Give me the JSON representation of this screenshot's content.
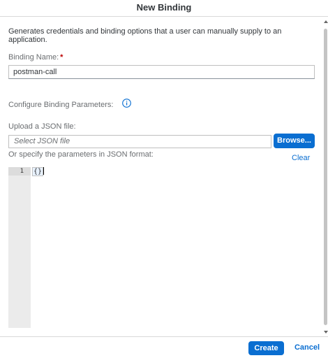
{
  "dialog": {
    "title": "New Binding"
  },
  "form": {
    "description": "Generates credentials and binding options that a user can manually supply to an application.",
    "binding_name_label": "Binding Name:",
    "required_marker": "*",
    "binding_name_value": "postman-call",
    "configure_label": "Configure Binding Parameters:",
    "info_icon": "info-icon",
    "upload_label": "Upload a JSON file:",
    "file_placeholder": "Select JSON file",
    "browse_label": "Browse...",
    "specify_label": "Or specify the parameters in JSON format:",
    "clear_label": "Clear"
  },
  "editor": {
    "line_number": "1",
    "content": "{}"
  },
  "footer": {
    "create_label": "Create",
    "cancel_label": "Cancel"
  },
  "colors": {
    "accent": "#0a6ed1",
    "required": "#bb0000",
    "label": "#6a6d70"
  }
}
